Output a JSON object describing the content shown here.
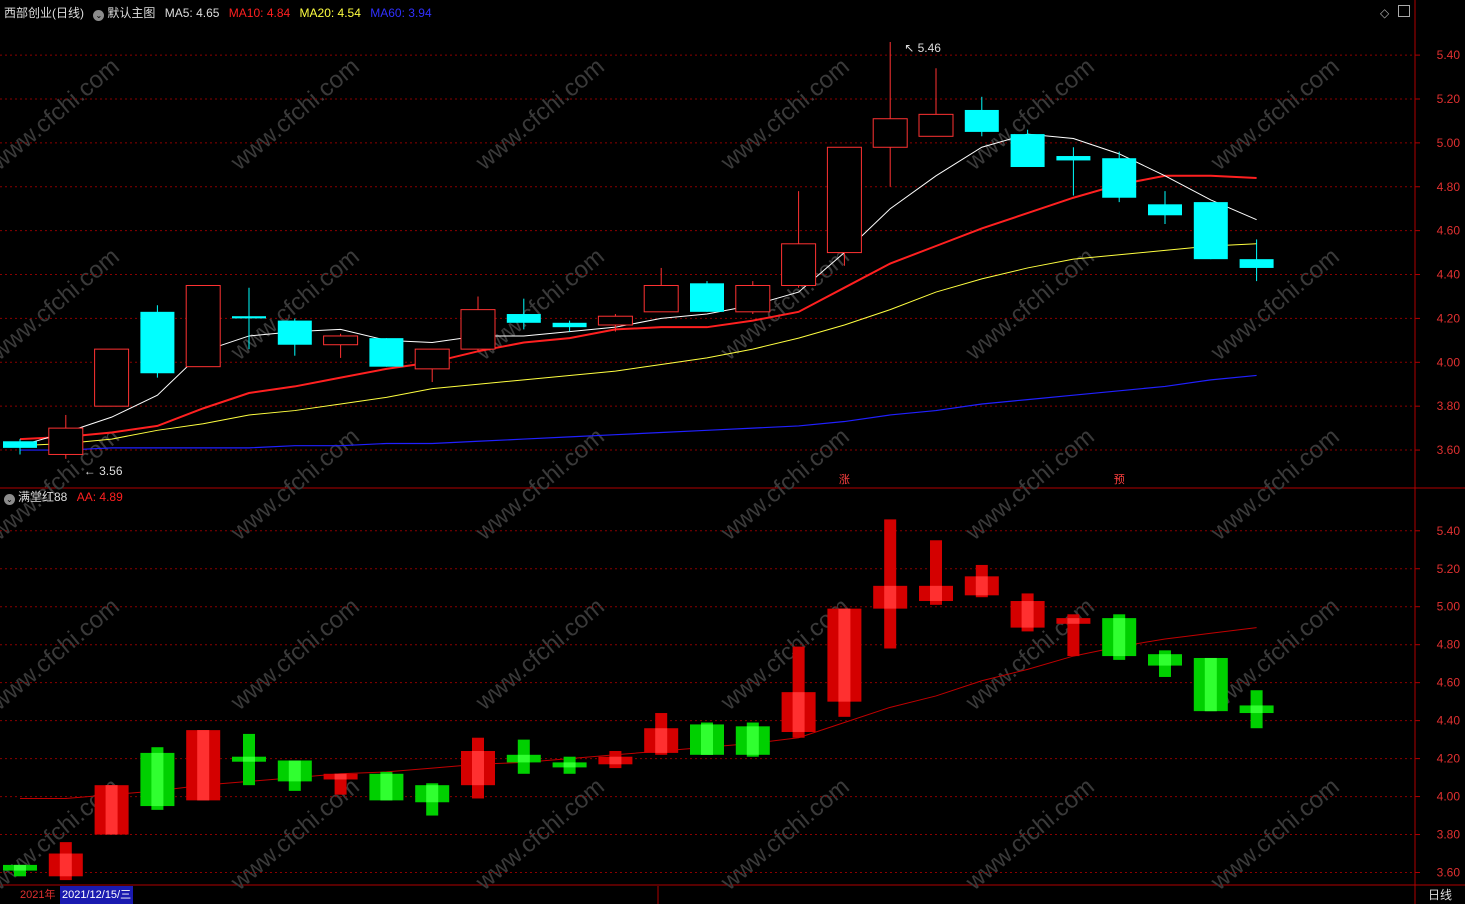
{
  "header": {
    "stock_name": "西部创业",
    "period_tag": "(日线)",
    "main_chart_name": "默认主图",
    "ma5_label": "MA5:",
    "ma5_value": "4.65",
    "ma10_label": "MA10:",
    "ma10_value": "4.84",
    "ma20_label": "MA20:",
    "ma20_value": "4.54",
    "ma60_label": "MA60:",
    "ma60_value": "3.94"
  },
  "indicator_header": {
    "name": "满堂红88",
    "aa_label": "AA:",
    "aa_value": "4.89"
  },
  "colors": {
    "up": "#ff3232",
    "down": "#00ffff",
    "ma5": "#ffffff",
    "ma10": "#ff2020",
    "ma20": "#ffff40",
    "ma60": "#2020ff",
    "grid": "#8b0000",
    "ind_up": "#d40000",
    "ind_down": "#00d000"
  },
  "bottom_bar": {
    "year_label": "2021年",
    "date_label": "2021/12/15/三",
    "period_button": "日线"
  },
  "top_icons": [
    "diamond-icon",
    "window-icon"
  ],
  "chart_data": [
    {
      "type": "candlestick",
      "title": "西部创业 (日线)",
      "ylim": [
        3.5,
        5.56
      ],
      "y_ticks": [
        "5.40",
        "5.20",
        "5.00",
        "4.80",
        "4.60",
        "4.40",
        "4.20",
        "4.00",
        "3.80",
        "3.60"
      ],
      "candles": [
        {
          "o": 3.64,
          "c": 3.61,
          "h": 3.65,
          "l": 3.58
        },
        {
          "o": 3.58,
          "c": 3.7,
          "h": 3.76,
          "l": 3.56
        },
        {
          "o": 3.8,
          "c": 4.06,
          "h": 4.06,
          "l": 3.8
        },
        {
          "o": 4.23,
          "c": 3.95,
          "h": 4.26,
          "l": 3.93
        },
        {
          "o": 3.98,
          "c": 4.35,
          "h": 4.35,
          "l": 3.98
        },
        {
          "o": 4.21,
          "c": 4.2,
          "h": 4.34,
          "l": 4.06
        },
        {
          "o": 4.19,
          "c": 4.08,
          "h": 4.2,
          "l": 4.03
        },
        {
          "o": 4.08,
          "c": 4.12,
          "h": 4.13,
          "l": 4.02
        },
        {
          "o": 4.11,
          "c": 3.98,
          "h": 4.11,
          "l": 3.98
        },
        {
          "o": 3.97,
          "c": 4.06,
          "h": 4.06,
          "l": 3.91
        },
        {
          "o": 4.06,
          "c": 4.24,
          "h": 4.3,
          "l": 4.05
        },
        {
          "o": 4.22,
          "c": 4.18,
          "h": 4.29,
          "l": 4.15
        },
        {
          "o": 4.18,
          "c": 4.16,
          "h": 4.19,
          "l": 4.14
        },
        {
          "o": 4.17,
          "c": 4.21,
          "h": 4.22,
          "l": 4.14
        },
        {
          "o": 4.23,
          "c": 4.35,
          "h": 4.43,
          "l": 4.23
        },
        {
          "o": 4.36,
          "c": 4.23,
          "h": 4.37,
          "l": 4.23
        },
        {
          "o": 4.23,
          "c": 4.35,
          "h": 4.37,
          "l": 4.22
        },
        {
          "o": 4.35,
          "c": 4.54,
          "h": 4.78,
          "l": 4.34
        },
        {
          "o": 4.5,
          "c": 4.98,
          "h": 4.98,
          "l": 4.44
        },
        {
          "o": 4.98,
          "c": 5.11,
          "h": 5.46,
          "l": 4.8
        },
        {
          "o": 5.03,
          "c": 5.13,
          "h": 5.34,
          "l": 5.03
        },
        {
          "o": 5.15,
          "c": 5.05,
          "h": 5.21,
          "l": 5.03
        },
        {
          "o": 5.04,
          "c": 4.89,
          "h": 5.06,
          "l": 4.89
        },
        {
          "o": 4.94,
          "c": 4.92,
          "h": 4.98,
          "l": 4.76
        },
        {
          "o": 4.93,
          "c": 4.75,
          "h": 4.96,
          "l": 4.73
        },
        {
          "o": 4.72,
          "c": 4.67,
          "h": 4.78,
          "l": 4.63
        },
        {
          "o": 4.73,
          "c": 4.47,
          "h": 4.73,
          "l": 4.47
        },
        {
          "o": 4.47,
          "c": 4.43,
          "h": 4.56,
          "l": 4.37
        }
      ],
      "ma5": [
        3.62,
        3.68,
        3.75,
        3.85,
        4.05,
        4.12,
        4.14,
        4.15,
        4.1,
        4.09,
        4.12,
        4.12,
        4.14,
        4.16,
        4.2,
        4.22,
        4.26,
        4.32,
        4.5,
        4.7,
        4.85,
        4.98,
        5.04,
        5.02,
        4.95,
        4.85,
        4.74,
        4.65
      ],
      "ma10": [
        3.65,
        3.66,
        3.68,
        3.71,
        3.79,
        3.86,
        3.89,
        3.93,
        3.97,
        4.0,
        4.05,
        4.09,
        4.11,
        4.15,
        4.16,
        4.16,
        4.19,
        4.23,
        4.34,
        4.45,
        4.53,
        4.61,
        4.68,
        4.75,
        4.81,
        4.85,
        4.85,
        4.84
      ],
      "ma20": [
        3.62,
        3.63,
        3.65,
        3.69,
        3.72,
        3.76,
        3.78,
        3.81,
        3.84,
        3.88,
        3.9,
        3.92,
        3.94,
        3.96,
        3.99,
        4.02,
        4.06,
        4.11,
        4.17,
        4.24,
        4.32,
        4.38,
        4.43,
        4.47,
        4.49,
        4.51,
        4.53,
        4.54
      ],
      "ma60": [
        3.6,
        3.6,
        3.61,
        3.61,
        3.61,
        3.61,
        3.62,
        3.62,
        3.63,
        3.63,
        3.64,
        3.65,
        3.66,
        3.67,
        3.68,
        3.69,
        3.7,
        3.71,
        3.73,
        3.76,
        3.78,
        3.81,
        3.83,
        3.85,
        3.87,
        3.89,
        3.92,
        3.94
      ],
      "annotations": [
        {
          "text": "5.46",
          "index": 19,
          "value": 5.46
        },
        {
          "text": "3.56",
          "index": 1,
          "value": 3.56
        }
      ],
      "markers": [
        {
          "text": "涨",
          "index": 18
        },
        {
          "text": "预",
          "index": 24
        }
      ]
    },
    {
      "type": "bar",
      "title": "满堂红88",
      "ylim": [
        3.55,
        5.52
      ],
      "y_ticks": [
        "5.40",
        "5.20",
        "5.00",
        "4.80",
        "4.60",
        "4.40",
        "4.20",
        "4.00",
        "3.80",
        "3.60"
      ],
      "bars": [
        {
          "o": 3.64,
          "c": 3.61,
          "h": 3.64,
          "l": 3.58
        },
        {
          "o": 3.58,
          "c": 3.7,
          "h": 3.76,
          "l": 3.56
        },
        {
          "o": 3.8,
          "c": 4.06,
          "h": 4.06,
          "l": 3.8
        },
        {
          "o": 4.23,
          "c": 3.95,
          "h": 4.26,
          "l": 3.93
        },
        {
          "o": 3.98,
          "c": 4.35,
          "h": 4.35,
          "l": 3.98
        },
        {
          "o": 4.21,
          "c": 4.2,
          "h": 4.33,
          "l": 4.06
        },
        {
          "o": 4.19,
          "c": 4.08,
          "h": 4.19,
          "l": 4.03
        },
        {
          "o": 4.09,
          "c": 4.12,
          "h": 4.12,
          "l": 4.01
        },
        {
          "o": 4.12,
          "c": 3.98,
          "h": 4.13,
          "l": 3.98
        },
        {
          "o": 4.06,
          "c": 3.97,
          "h": 4.07,
          "l": 3.9
        },
        {
          "o": 4.06,
          "c": 4.24,
          "h": 4.31,
          "l": 3.99
        },
        {
          "o": 4.22,
          "c": 4.18,
          "h": 4.3,
          "l": 4.12
        },
        {
          "o": 4.18,
          "c": 4.16,
          "h": 4.21,
          "l": 4.12
        },
        {
          "o": 4.17,
          "c": 4.21,
          "h": 4.24,
          "l": 4.15
        },
        {
          "o": 4.23,
          "c": 4.36,
          "h": 4.44,
          "l": 4.22
        },
        {
          "o": 4.38,
          "c": 4.22,
          "h": 4.39,
          "l": 4.22
        },
        {
          "o": 4.37,
          "c": 4.22,
          "h": 4.39,
          "l": 4.21
        },
        {
          "o": 4.34,
          "c": 4.55,
          "h": 4.79,
          "l": 4.31
        },
        {
          "o": 4.5,
          "c": 4.99,
          "h": 4.99,
          "l": 4.42
        },
        {
          "o": 4.99,
          "c": 5.11,
          "h": 5.46,
          "l": 4.78
        },
        {
          "o": 5.03,
          "c": 5.11,
          "h": 5.35,
          "l": 5.01
        },
        {
          "o": 5.06,
          "c": 5.16,
          "h": 5.22,
          "l": 5.05
        },
        {
          "o": 4.89,
          "c": 5.03,
          "h": 5.07,
          "l": 4.87
        },
        {
          "o": 4.91,
          "c": 4.94,
          "h": 4.96,
          "l": 4.74
        },
        {
          "o": 4.94,
          "c": 4.74,
          "h": 4.96,
          "l": 4.72
        },
        {
          "o": 4.75,
          "c": 4.69,
          "h": 4.77,
          "l": 4.63
        },
        {
          "o": 4.73,
          "c": 4.45,
          "h": 4.73,
          "l": 4.45
        },
        {
          "o": 4.48,
          "c": 4.44,
          "h": 4.56,
          "l": 4.36
        }
      ],
      "aa": [
        3.99,
        3.99,
        4.01,
        4.03,
        4.06,
        4.08,
        4.1,
        4.12,
        4.13,
        4.15,
        4.17,
        4.18,
        4.2,
        4.22,
        4.24,
        4.26,
        4.28,
        4.31,
        4.39,
        4.47,
        4.53,
        4.61,
        4.67,
        4.74,
        4.79,
        4.83,
        4.86,
        4.89
      ]
    }
  ]
}
